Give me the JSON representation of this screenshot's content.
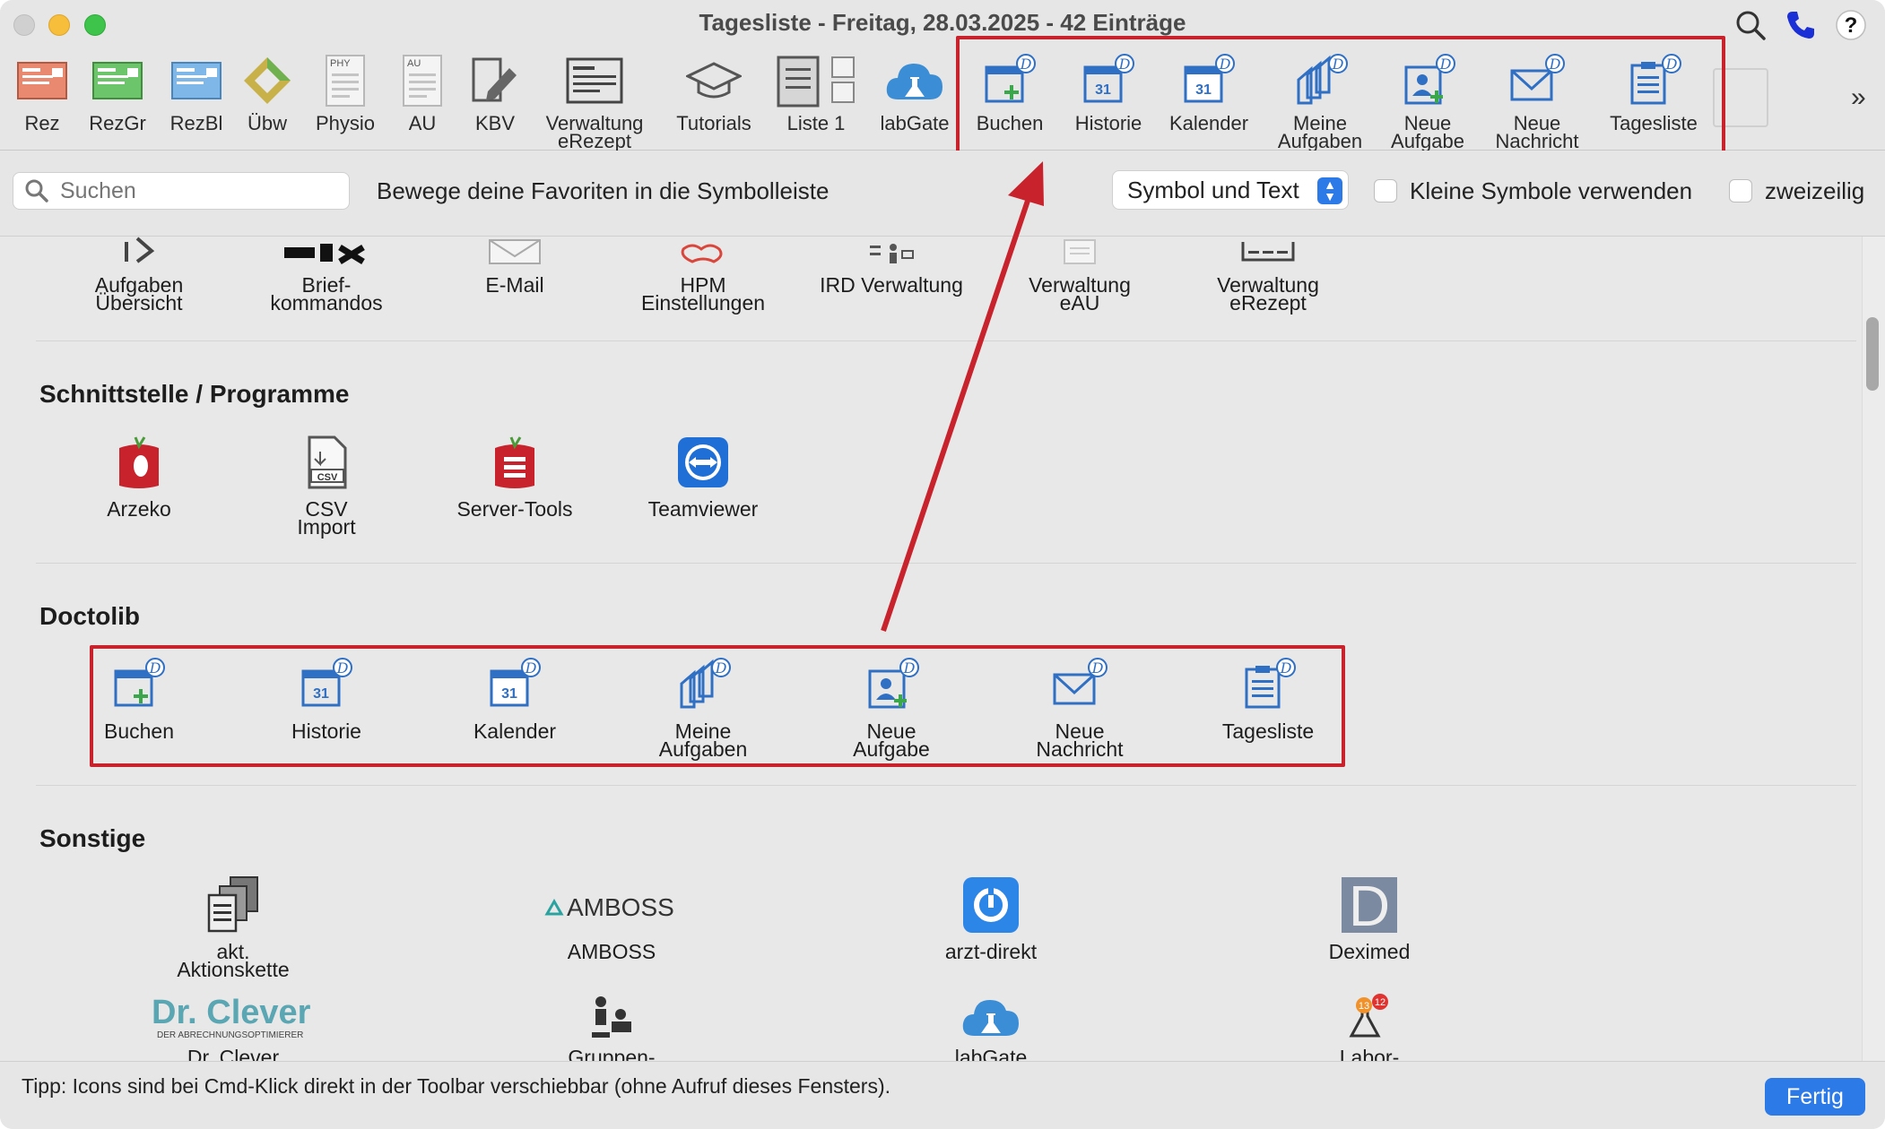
{
  "window": {
    "title": "Tagesliste - Freitag, 28.03.2025 - 42 Einträge"
  },
  "toolbar": {
    "items": [
      {
        "label": "Rez",
        "icon": "prescription-red-icon"
      },
      {
        "label": "RezGr",
        "icon": "prescription-green-icon"
      },
      {
        "label": "RezBl",
        "icon": "prescription-blue-icon"
      },
      {
        "label": "Übw",
        "icon": "referral-icon"
      },
      {
        "label": "Physio",
        "icon": "physio-form-icon",
        "badge": "PHY"
      },
      {
        "label": "AU",
        "icon": "sick-note-icon",
        "badge": "AU"
      },
      {
        "label": "KBV",
        "icon": "kbv-form-icon"
      },
      {
        "label": "Verwaltung\neRezept",
        "icon": "erezept-admin-icon"
      },
      {
        "label": "Tutorials",
        "icon": "graduation-cap-icon"
      },
      {
        "label": "Liste 1",
        "icon": "list-icon"
      },
      {
        "label": "labGate",
        "icon": "labgate-cloud-icon"
      },
      {
        "label": "Buchen",
        "icon": "doctolib-booking-icon"
      },
      {
        "label": "Historie",
        "icon": "doctolib-history-icon"
      },
      {
        "label": "Kalender",
        "icon": "doctolib-calendar-icon"
      },
      {
        "label": "Meine\nAufgaben",
        "icon": "doctolib-my-tasks-icon"
      },
      {
        "label": "Neue\nAufgabe",
        "icon": "doctolib-new-task-icon"
      },
      {
        "label": "Neue\nNachricht",
        "icon": "doctolib-new-message-icon"
      },
      {
        "label": "Tagesliste",
        "icon": "doctolib-day-list-icon"
      }
    ],
    "overflow_icon": "chevron-double-right-icon"
  },
  "options": {
    "search_placeholder": "Suchen",
    "hint": "Bewege deine Favoriten in die Symbolleiste",
    "display_mode": "Symbol und Text",
    "small_icons_label": "Kleine Symbole verwenden",
    "small_icons_checked": false,
    "two_rows_label": "zweizeilig",
    "two_rows_checked": false
  },
  "sections": {
    "top_row": [
      {
        "label": "Aufgaben\nÜbersicht"
      },
      {
        "label": "Brief-\nkommandos"
      },
      {
        "label": "E-Mail"
      },
      {
        "label": "HPM\nEinstellungen"
      },
      {
        "label": "IRD Verwaltung"
      },
      {
        "label": "Verwaltung\neAU"
      },
      {
        "label": "Verwaltung\neRezept"
      }
    ],
    "schnittstelle": {
      "title": "Schnittstelle / Programme",
      "items": [
        {
          "label": "Arzeko"
        },
        {
          "label": "CSV\nImport",
          "badge": "CSV"
        },
        {
          "label": "Server-Tools"
        },
        {
          "label": "Teamviewer"
        }
      ]
    },
    "doctolib": {
      "title": "Doctolib",
      "calendar_day": "31",
      "badge": "D",
      "items": [
        {
          "label": "Buchen"
        },
        {
          "label": "Historie"
        },
        {
          "label": "Kalender"
        },
        {
          "label": "Meine\nAufgaben"
        },
        {
          "label": "Neue\nAufgabe"
        },
        {
          "label": "Neue\nNachricht"
        },
        {
          "label": "Tagesliste"
        }
      ]
    },
    "sonstige": {
      "title": "Sonstige",
      "items": [
        {
          "label": "akt.\nAktionskette"
        },
        {
          "label": "AMBOSS",
          "logo_text": "AMBOSS"
        },
        {
          "label": "arzt-direkt"
        },
        {
          "label": "Deximed",
          "logo_text": "D"
        },
        {
          "label": "Dr. Clever",
          "logo_text": "Dr. Clever",
          "logo_sub": "DER ABRECHNUNGSOPTIMIERER"
        },
        {
          "label": "Gruppen-"
        },
        {
          "label": "labGate"
        },
        {
          "label": "Labor-",
          "badge_a": "13",
          "badge_b": "12"
        }
      ]
    }
  },
  "footer": {
    "tip": "Tipp: Icons sind bei Cmd-Klick direkt in der Toolbar verschiebbar (ohne Aufruf dieses Fensters).",
    "done_label": "Fertig"
  },
  "colors": {
    "accent": "#2c79e8",
    "doctolib_blue": "#2f6fc4",
    "highlight_red": "#c8232c"
  }
}
